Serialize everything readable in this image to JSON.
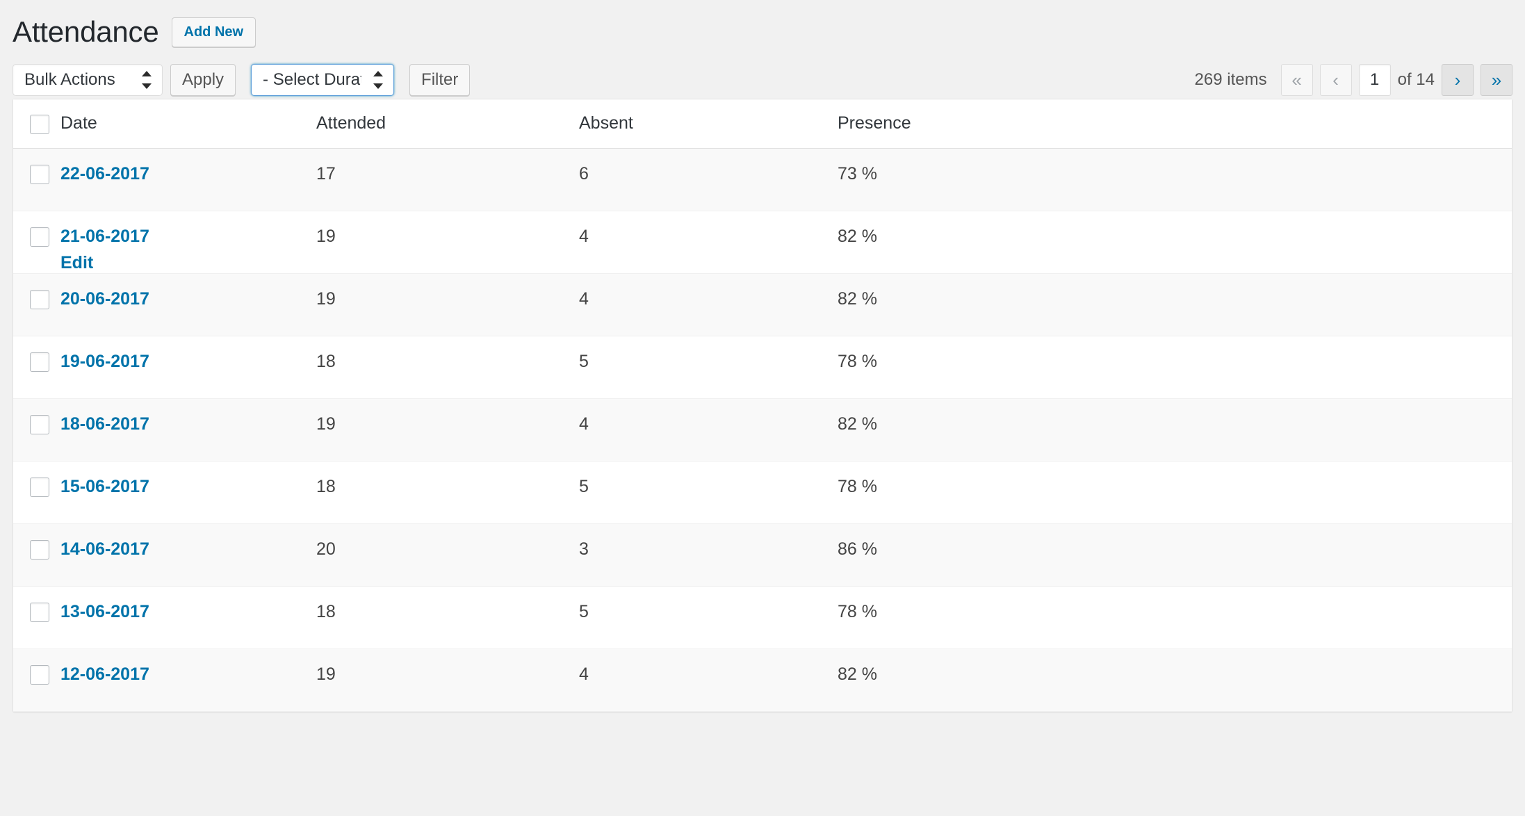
{
  "header": {
    "title": "Attendance",
    "add_new_label": "Add New"
  },
  "toolbar": {
    "bulk_actions": {
      "selected": "Bulk Actions",
      "options": [
        "Bulk Actions"
      ]
    },
    "apply_label": "Apply",
    "duration": {
      "selected": "- Select Duration -",
      "options": [
        "- Select Duration -"
      ]
    },
    "filter_label": "Filter"
  },
  "pagination": {
    "items_count": "269 items",
    "first_label": "«",
    "prev_label": "‹",
    "current_page": "1",
    "of_label": "of 14",
    "next_label": "›",
    "last_label": "»"
  },
  "table": {
    "columns": {
      "date": "Date",
      "attended": "Attended",
      "absent": "Absent",
      "presence": "Presence"
    },
    "row_action_edit": "Edit",
    "rows": [
      {
        "date": "22-06-2017",
        "attended": "17",
        "absent": "6",
        "presence": "73 %"
      },
      {
        "date": "21-06-2017",
        "attended": "19",
        "absent": "4",
        "presence": "82 %"
      },
      {
        "date": "20-06-2017",
        "attended": "19",
        "absent": "4",
        "presence": "82 %"
      },
      {
        "date": "19-06-2017",
        "attended": "18",
        "absent": "5",
        "presence": "78 %"
      },
      {
        "date": "18-06-2017",
        "attended": "19",
        "absent": "4",
        "presence": "82 %"
      },
      {
        "date": "15-06-2017",
        "attended": "18",
        "absent": "5",
        "presence": "78 %"
      },
      {
        "date": "14-06-2017",
        "attended": "20",
        "absent": "3",
        "presence": "86 %"
      },
      {
        "date": "13-06-2017",
        "attended": "18",
        "absent": "5",
        "presence": "78 %"
      },
      {
        "date": "12-06-2017",
        "attended": "19",
        "absent": "4",
        "presence": "82 %"
      }
    ]
  },
  "colors": {
    "link": "#0073aa",
    "background": "#f1f1f1",
    "focus_border": "#5b9dd9"
  }
}
